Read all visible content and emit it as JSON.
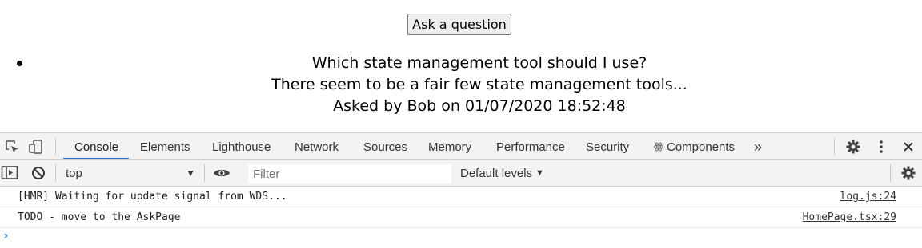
{
  "page": {
    "ask_button": "Ask a question",
    "question": {
      "title": "Which state management tool should I use?",
      "content": "There seem to be a fair few state management tools...",
      "meta": "Asked by Bob on 01/07/2020 18:52:48"
    }
  },
  "devtools": {
    "tabs": [
      {
        "label": "Console",
        "active": true
      },
      {
        "label": "Elements"
      },
      {
        "label": "Lighthouse"
      },
      {
        "label": "Network"
      },
      {
        "label": "Sources"
      },
      {
        "label": "Memory"
      },
      {
        "label": "Performance"
      },
      {
        "label": "Security"
      },
      {
        "label": "Components"
      }
    ],
    "more_tabs": "»",
    "context": "top",
    "filter_placeholder": "Filter",
    "levels": "Default levels",
    "logs": [
      {
        "message": "[HMR] Waiting for update signal from WDS...",
        "source": "log.js:24"
      },
      {
        "message": "TODO - move to the AskPage",
        "source": "HomePage.tsx:29"
      }
    ],
    "prompt": "›",
    "accent": "#1a73e8"
  }
}
